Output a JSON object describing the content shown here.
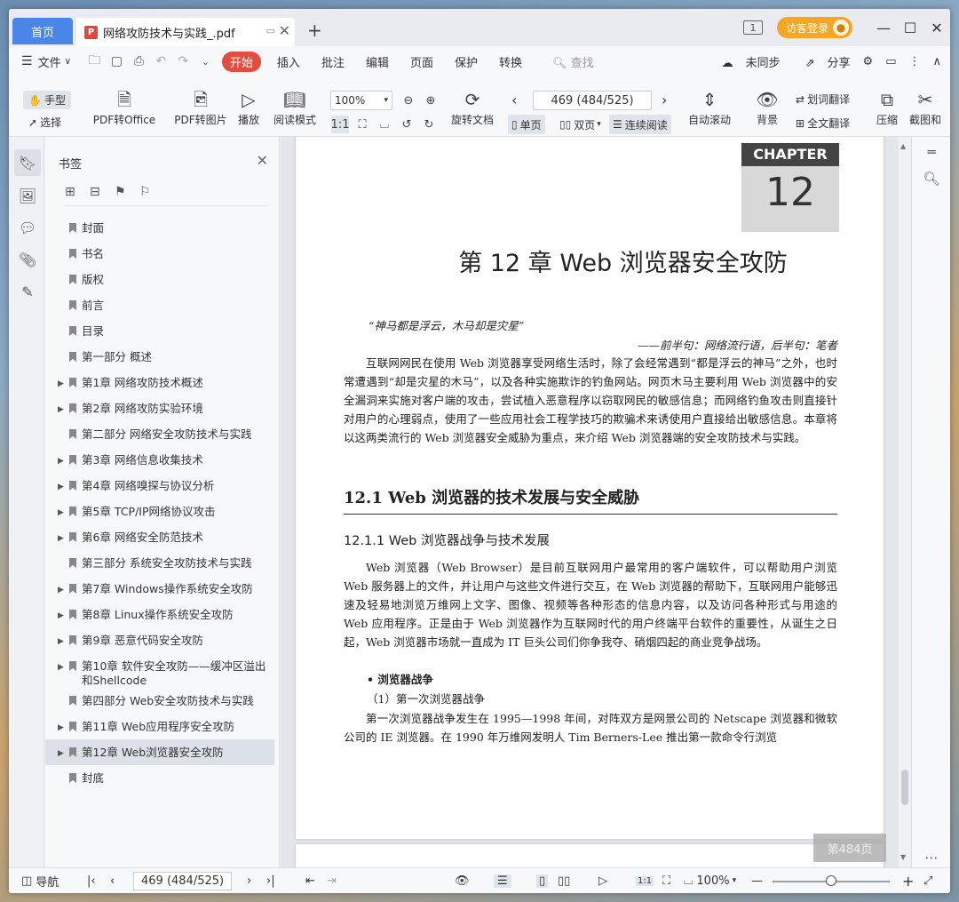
{
  "titlebar": {
    "home_tab": "首页",
    "doc_tab": "网络攻防技术与实践_.pdf",
    "login": "访客登录"
  },
  "menu": {
    "file": "文件",
    "tabs": [
      "开始",
      "插入",
      "批注",
      "编辑",
      "页面",
      "保护",
      "转换"
    ],
    "search": "查找",
    "unsynced": "未同步",
    "share": "分享"
  },
  "toolbar": {
    "hand": "手型",
    "select": "选择",
    "pdf_to_office": "PDF转Office",
    "pdf_to_image": "PDF转图片",
    "play": "播放",
    "read_mode": "阅读模式",
    "zoom": "100%",
    "rotate_doc": "旋转文档",
    "page_input": "469 (484/525)",
    "single": "单页",
    "double": "双页",
    "continuous": "连续阅读",
    "auto_scroll": "自动滚动",
    "background": "背景",
    "word_translate": "划词翻译",
    "full_translate": "全文翻译",
    "compress": "压缩",
    "screenshot": "截图和"
  },
  "bookmarks": {
    "title": "书签",
    "items": [
      {
        "label": "封面",
        "expandable": false
      },
      {
        "label": "书名",
        "expandable": false
      },
      {
        "label": "版权",
        "expandable": false
      },
      {
        "label": "前言",
        "expandable": false
      },
      {
        "label": "目录",
        "expandable": false
      },
      {
        "label": "第一部分  概述",
        "expandable": false
      },
      {
        "label": "第1章  网络攻防技术概述",
        "expandable": true
      },
      {
        "label": "第2章  网络攻防实验环境",
        "expandable": true
      },
      {
        "label": "第二部分  网络安全攻防技术与实践",
        "expandable": false
      },
      {
        "label": "第3章  网络信息收集技术",
        "expandable": true
      },
      {
        "label": "第4章  网络嗅探与协议分析",
        "expandable": true
      },
      {
        "label": "第5章  TCP/IP网络协议攻击",
        "expandable": true
      },
      {
        "label": "第6章  网络安全防范技术",
        "expandable": true
      },
      {
        "label": "第三部分  系统安全攻防技术与实践",
        "expandable": false
      },
      {
        "label": "第7章  Windows操作系统安全攻防",
        "expandable": true
      },
      {
        "label": "第8章  Linux操作系统安全攻防",
        "expandable": true
      },
      {
        "label": "第9章  恶意代码安全攻防",
        "expandable": true
      },
      {
        "label": "第10章  软件安全攻防——缓冲区溢出和Shellcode",
        "expandable": true
      },
      {
        "label": "第四部分  Web安全攻防技术与实践",
        "expandable": false
      },
      {
        "label": "第11章  Web应用程序安全攻防",
        "expandable": true
      },
      {
        "label": "第12章  Web浏览器安全攻防",
        "expandable": true,
        "selected": true
      },
      {
        "label": "封底",
        "expandable": false
      }
    ]
  },
  "page": {
    "chapter_label": "CHAPTER",
    "chapter_num": "12",
    "title": "第 12 章   Web 浏览器安全攻防",
    "quote": "“神马都是浮云，木马却是灾星”",
    "quote_by": "——前半句：网络流行语，后半句：笔者",
    "intro": "互联网网民在使用 Web 浏览器享受网络生活时，除了会经常遇到“都是浮云的神马”之外，也时常遭遇到“却是灾星的木马”，以及各种实施欺诈的钓鱼网站。网页木马主要利用 Web 浏览器中的安全漏洞来实施对客户端的攻击，尝试植入恶意程序以窃取网民的敏感信息；而网络钓鱼攻击则直接针对用户的心理弱点，使用了一些应用社会工程学技巧的欺骗术来诱使用户直接给出敏感信息。本章将以这两类流行的 Web 浏览器安全威胁为重点，来介绍 Web 浏览器端的安全攻防技术与实践。",
    "h2": "12.1   Web 浏览器的技术发展与安全威胁",
    "h3": "12.1.1   Web 浏览器战争与技术发展",
    "body1": "Web 浏览器（Web Browser）是目前互联网用户最常用的客户端软件，可以帮助用户浏览 Web 服务器上的文件，并让用户与这些文件进行交互，在 Web 浏览器的帮助下，互联网用户能够迅速及轻易地浏览万维网上文字、图像、视频等各种形态的信息内容，以及访问各种形式与用途的 Web 应用程序。正是由于 Web 浏览器作为互联网时代的用户终端平台软件的重要性，从诞生之日起，Web 浏览器市场就一直成为 IT 巨头公司们你争我夺、硝烟四起的商业竞争战场。",
    "bullet": "浏览器战争",
    "sub": "（1）第一次浏览器战争",
    "body2": "第一次浏览器战争发生在 1995—1998 年间，对阵双方是网景公司的 Netscape 浏览器和微软公司的 IE 浏览器。在 1990 年万维网发明人 Tim Berners-Lee 推出第一款命令行浏览"
  },
  "page_toast": "第484页",
  "statusbar": {
    "nav": "导航",
    "page": "469 (484/525)",
    "zoom": "100%",
    "zoom_level": 0.5
  }
}
